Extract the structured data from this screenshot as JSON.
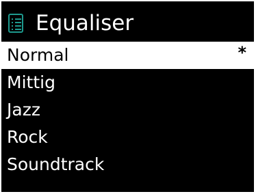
{
  "header": {
    "title": "Equaliser",
    "icon": "menu-list-icon",
    "icon_color": "#1e9a8e"
  },
  "list": {
    "items": [
      {
        "label": "Normal",
        "marker": "*",
        "selected": true
      },
      {
        "label": "Mittig",
        "marker": "",
        "selected": false
      },
      {
        "label": "Jazz",
        "marker": "",
        "selected": false
      },
      {
        "label": "Rock",
        "marker": "",
        "selected": false
      },
      {
        "label": "Soundtrack",
        "marker": "",
        "selected": false
      }
    ]
  },
  "colors": {
    "background": "#000000",
    "text": "#ffffff",
    "highlight_background": "#ffffff",
    "highlight_text": "#000000"
  }
}
